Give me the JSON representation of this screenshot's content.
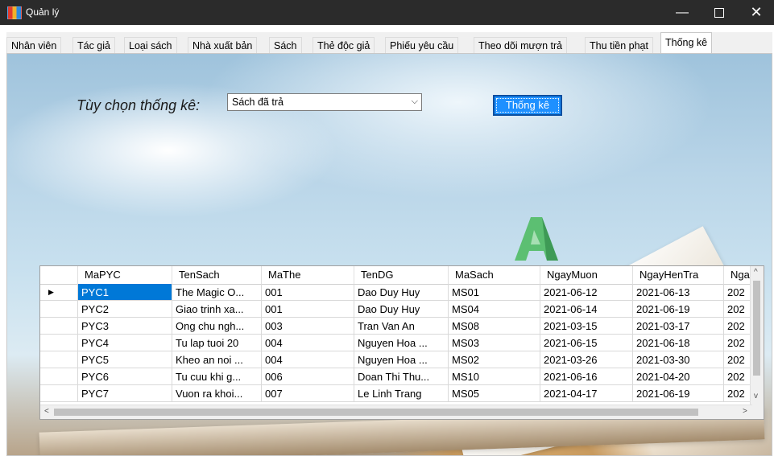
{
  "window": {
    "title": "Quản lý",
    "min_label": "—",
    "close_label": "✕"
  },
  "tabs": [
    "Nhân viên",
    "Tác giả",
    "Loại sách",
    "Nhà xuất bản",
    "Sách",
    "Thẻ độc giả",
    "Phiếu yêu cầu",
    "Theo dõi mượn trả",
    "Thu tiền phạt",
    "Thống kê"
  ],
  "active_tab": "Thống kê",
  "form": {
    "option_label": "Tùy chọn thống kê:",
    "option_value": "Sách đã trả",
    "dropdown_arrow": "⌵",
    "button_label": "Thống kê"
  },
  "grid": {
    "columns": [
      "MaPYC",
      "TenSach",
      "MaThe",
      "TenDG",
      "MaSach",
      "NgayMuon",
      "NgayHenTra",
      "Nga"
    ],
    "current_row_marker": "▶",
    "rows": [
      [
        "PYC1",
        "The Magic O...",
        "001",
        "Dao Duy Huy",
        "MS01",
        "2021-06-12",
        "2021-06-13",
        "202"
      ],
      [
        "PYC2",
        "Giao trinh xa...",
        "001",
        "Dao Duy Huy",
        "MS04",
        "2021-06-14",
        "2021-06-19",
        "202"
      ],
      [
        "PYC3",
        "Ong chu ngh...",
        "003",
        "Tran Van An",
        "MS08",
        "2021-03-15",
        "2021-03-17",
        "202"
      ],
      [
        "PYC4",
        "Tu lap tuoi 20",
        "004",
        "Nguyen Hoa ...",
        "MS03",
        "2021-06-15",
        "2021-06-18",
        "202"
      ],
      [
        "PYC5",
        "Kheo an noi ...",
        "004",
        "Nguyen Hoa ...",
        "MS02",
        "2021-03-26",
        "2021-03-30",
        "202"
      ],
      [
        "PYC6",
        "Tu cuu khi g...",
        "006",
        "Doan Thi Thu...",
        "MS10",
        "2021-06-16",
        "2021-04-20",
        "202"
      ],
      [
        "PYC7",
        "Vuon ra khoi...",
        "007",
        "Le Linh Trang",
        "MS05",
        "2021-04-17",
        "2021-06-19",
        "202"
      ]
    ],
    "scroll_up": "^",
    "scroll_down": "v",
    "scroll_left": "<",
    "scroll_right": ">"
  },
  "colors": {
    "selection": "#0078d7",
    "button": "#1e90ff",
    "titlebar": "#2b2b2b"
  }
}
